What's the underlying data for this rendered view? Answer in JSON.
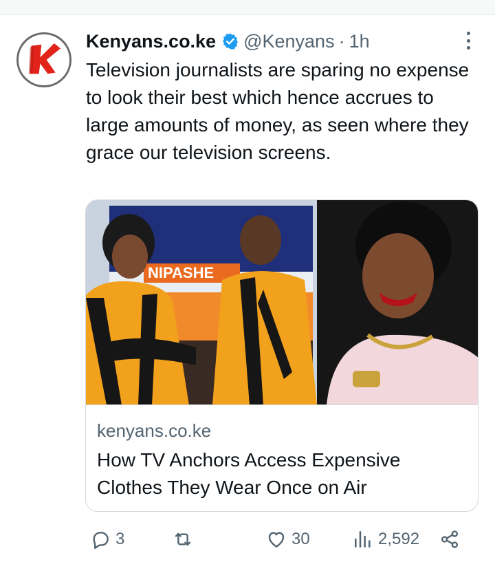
{
  "tweet": {
    "author_name": "Kenyans.co.ke",
    "handle": "@Kenyans",
    "separator": "·",
    "time": "1h",
    "text": "Television journalists are sparing no expense to look their best which hence accrues to large amounts of money, as seen where they grace our television screens.",
    "verified": true
  },
  "card": {
    "domain": "kenyans.co.ke",
    "title": "How TV Anchors Access Expensive Clothes They Wear Once on Air",
    "image_banner_text": "NIPASHE"
  },
  "actions": {
    "replies": "3",
    "likes": "30",
    "views": "2,592"
  },
  "icons": {
    "avatar": "kenyans-logo-icon",
    "verified": "verified-badge-icon",
    "more": "more-options-icon",
    "reply": "reply-icon",
    "retweet": "retweet-icon",
    "like": "heart-icon",
    "views": "analytics-icon",
    "share": "share-icon"
  },
  "colors": {
    "accent": "#1d9bf0",
    "text_primary": "#0f1419",
    "text_secondary": "#536471",
    "logo_red": "#e2231a",
    "border": "#cfd9de"
  }
}
